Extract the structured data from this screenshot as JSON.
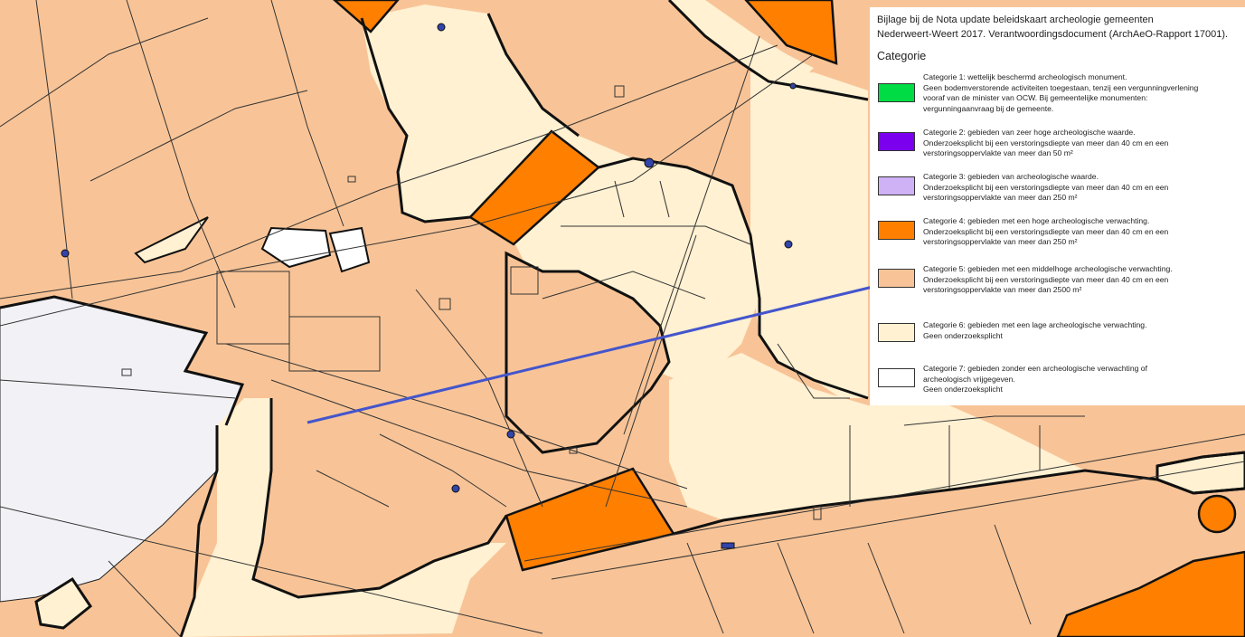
{
  "legend": {
    "title_line1": "Bijlage bij de Nota update beleidskaart archeologie gemeenten",
    "title_line2": "Nederweert-Weert 2017. Verantwoordingsdocument (ArchAeO-Rapport 17001).",
    "heading": "Categorie",
    "items": [
      {
        "color": "#00dd44",
        "lines": [
          "Categorie 1: wettelijk beschermd archeologisch monument.",
          "Geen bodemverstorende activiteiten toegestaan, tenzij een vergunningverlening",
          "vooraf van de minister van OCW. Bij gemeentelijke monumenten:",
          "vergunningaanvraag bij de gemeente."
        ]
      },
      {
        "color": "#7a00ee",
        "lines": [
          "Categorie 2: gebieden van zeer hoge archeologische waarde.",
          "Onderzoeksplicht bij een verstoringsdiepte van meer dan 40 cm en een",
          "verstoringsoppervlakte van meer dan 50 m²"
        ]
      },
      {
        "color": "#cfb1f5",
        "lines": [
          "Categorie 3: gebieden van archeologische waarde.",
          "Onderzoeksplicht bij een verstoringsdiepte van meer dan 40 cm en een",
          "verstoringsoppervlakte van meer dan 250 m²"
        ]
      },
      {
        "color": "#ff7f00",
        "lines": [
          "Categorie 4: gebieden met een hoge archeologische verwachting.",
          "Onderzoeksplicht bij een verstoringsdiepte van meer dan 40 cm en een",
          "verstoringsoppervlakte van meer dan 250 m²"
        ]
      },
      {
        "color": "#f8c497",
        "lines": [
          "Categorie 5: gebieden met een middelhoge archeologische verwachting.",
          "Onderzoeksplicht bij een verstoringsdiepte van meer dan 40 cm en een",
          "verstoringsoppervlakte van meer dan 2500 m²"
        ]
      },
      {
        "color": "#fff1d2",
        "lines": [
          "Categorie 6: gebieden met een lage archeologische verwachting.",
          "Geen onderzoeksplicht"
        ]
      },
      {
        "color": "#ffffff",
        "lines": [
          "Categorie 7: gebieden zonder een archeologische verwachting of",
          "archeologisch vrijgegeven.",
          "Geen onderzoeksplicht"
        ]
      }
    ]
  }
}
